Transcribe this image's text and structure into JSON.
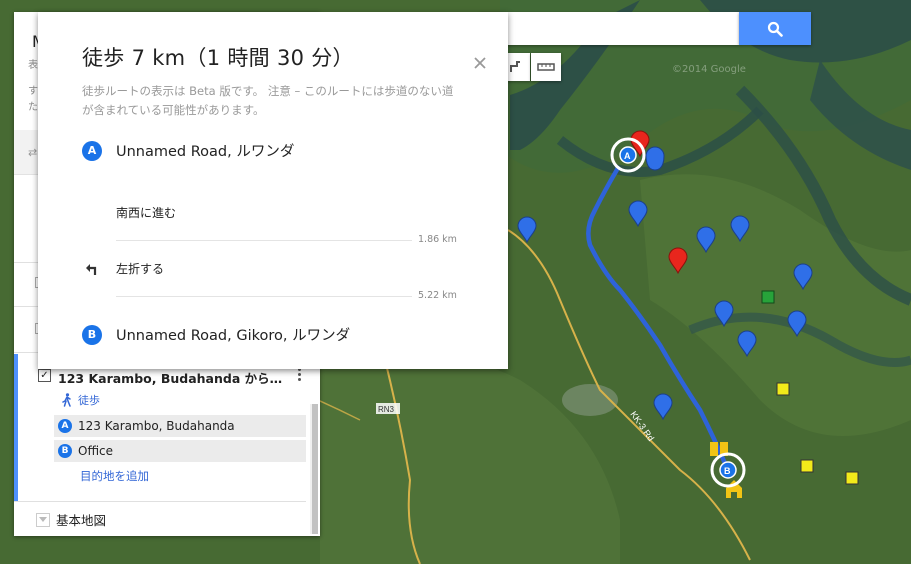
{
  "panel": {
    "title": "M",
    "subtitle": "表",
    "line1": "す",
    "line2": "た"
  },
  "layer": {
    "title": "123 Karambo, Budahanda から O…",
    "mode_label": "徒歩",
    "stops": [
      {
        "badge": "A",
        "label": "123 Karambo, Budahanda"
      },
      {
        "badge": "B",
        "label": "Office"
      }
    ],
    "add_destination": "目的地を追加",
    "checkmark": "✓"
  },
  "basemap_label": "基本地図",
  "directions": {
    "title": "徒歩 7 km（1 時間 30 分）",
    "note": "徒歩ルートの表示は Beta 版です。 注意 – このルートには歩道のない道が含まれている可能性があります。",
    "origin": {
      "badge": "A",
      "label": "Unnamed Road, ルワンダ"
    },
    "steps": [
      {
        "label": "南西に進む",
        "distance": "1.86 km"
      },
      {
        "label": "左折する",
        "distance": "5.22 km"
      }
    ],
    "destination": {
      "badge": "B",
      "label": "Unnamed Road, Gikoro, ルワンダ"
    }
  },
  "map": {
    "copyright": "©2014 Google",
    "road_labels": {
      "rn3": "RN3",
      "kk3": "KK-3 Rd"
    },
    "marker_a": "A",
    "marker_b": "B",
    "route_color": "#2e63d9",
    "pin_blue": "#2f6fe8",
    "pin_red": "#e8261d"
  },
  "icons": {
    "search": "search-icon",
    "close": "close-icon",
    "turn_left": "turn-left-icon",
    "walk": "walk-icon",
    "ruler": "ruler-icon"
  }
}
